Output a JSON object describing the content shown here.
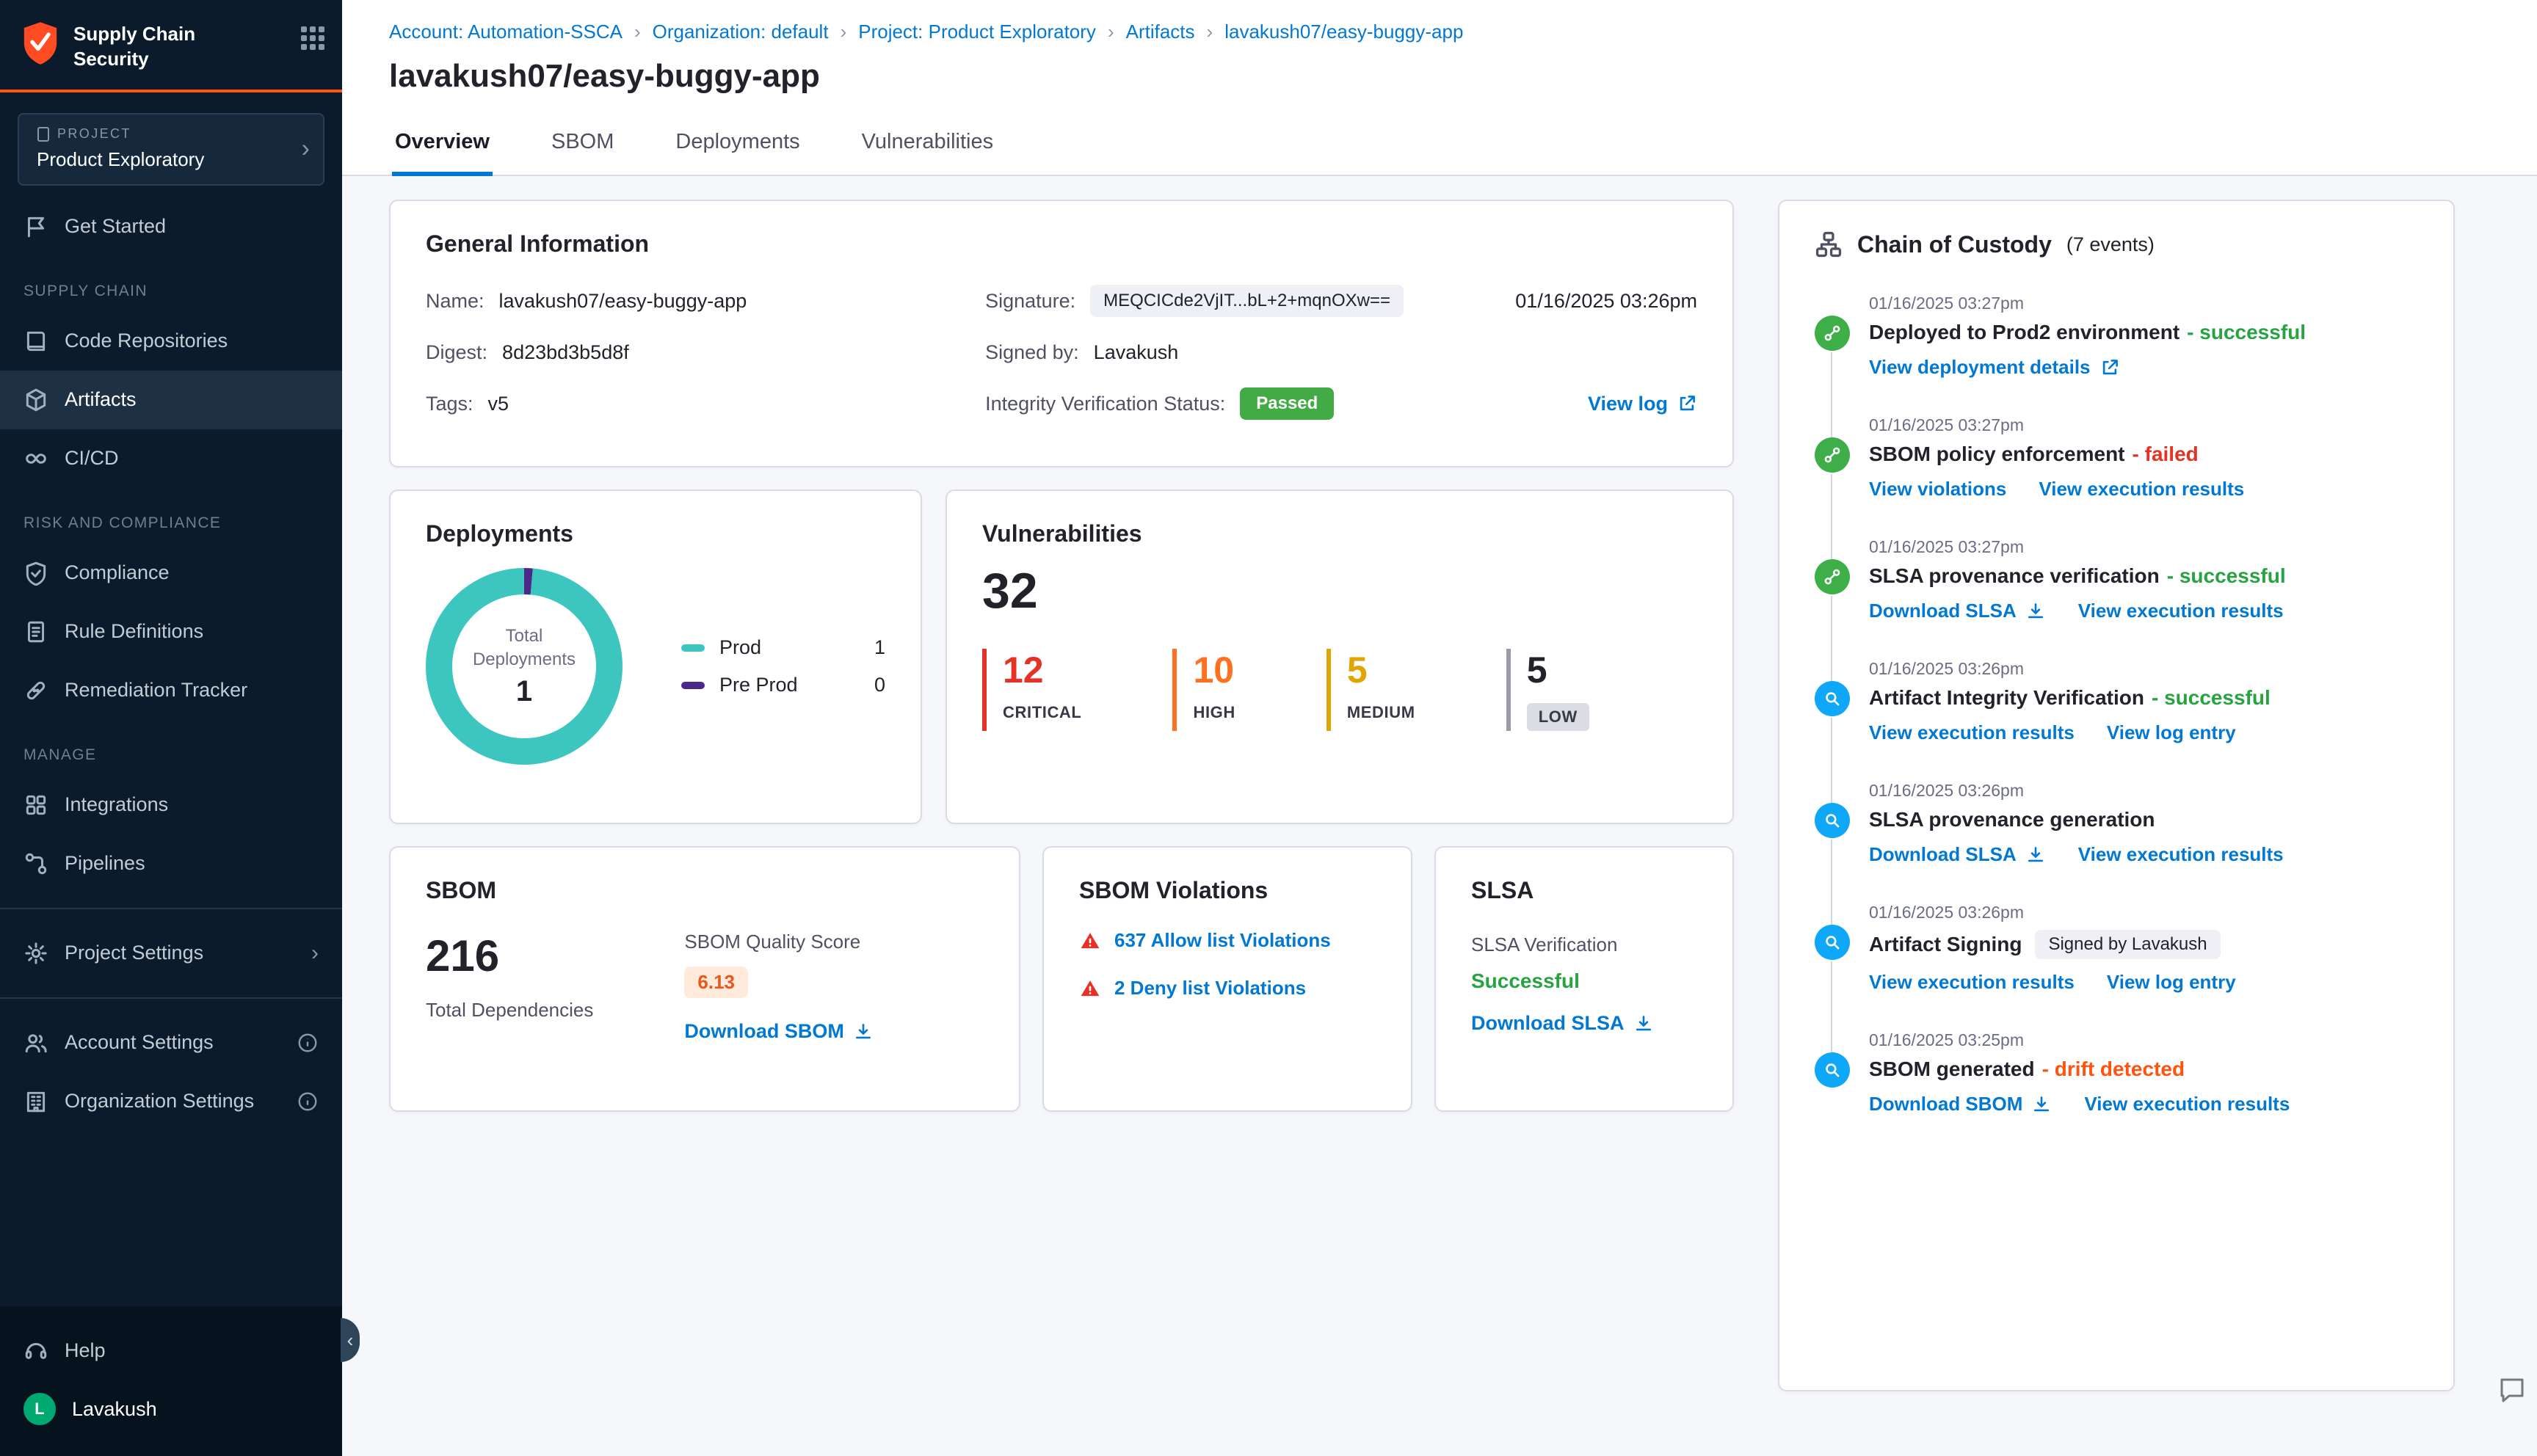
{
  "colors": {
    "primary_blue": "#0278d5",
    "success_green": "#27a341",
    "passed_badge_green": "#42ab45",
    "critical_red": "#e43326",
    "high_orange": "#ff7020",
    "medium_amber": "#e0a500",
    "drift_orange": "#ff5310",
    "teal_prod": "#3dc6c0",
    "purple_preprod": "#4c2889",
    "sidebar_bg": "#0b1b2b",
    "accent_orange": "#ff5310"
  },
  "icons": {
    "chevron_right": "›",
    "chevron_left": "‹"
  },
  "sidebar": {
    "app_title_line1": "Supply Chain",
    "app_title_line2": "Security",
    "project": {
      "label": "PROJECT",
      "name": "Product Exploratory"
    },
    "nav": {
      "get_started": "Get Started",
      "supply_chain_header": "SUPPLY CHAIN",
      "code_repositories": "Code Repositories",
      "artifacts": "Artifacts",
      "cicd": "CI/CD",
      "risk_header": "RISK AND COMPLIANCE",
      "compliance": "Compliance",
      "rule_definitions": "Rule Definitions",
      "remediation_tracker": "Remediation Tracker",
      "manage_header": "MANAGE",
      "integrations": "Integrations",
      "pipelines": "Pipelines",
      "project_settings": "Project Settings",
      "account_settings": "Account Settings",
      "organization_settings": "Organization Settings",
      "help": "Help"
    },
    "user": {
      "initial": "L",
      "name": "Lavakush"
    }
  },
  "breadcrumb": {
    "items": [
      "Account: Automation-SSCA",
      "Organization: default",
      "Project: Product Exploratory",
      "Artifacts",
      "lavakush07/easy-buggy-app"
    ]
  },
  "page": {
    "title": "lavakush07/easy-buggy-app"
  },
  "tabs": {
    "overview": "Overview",
    "sbom": "SBOM",
    "deployments": "Deployments",
    "vulnerabilities": "Vulnerabilities"
  },
  "general_info": {
    "title": "General Information",
    "name_label": "Name:",
    "name_value": "lavakush07/easy-buggy-app",
    "digest_label": "Digest:",
    "digest_value": "8d23bd3b5d8f",
    "tags_label": "Tags:",
    "tags_value": "v5",
    "signature_label": "Signature:",
    "signature_value": "MEQCICde2VjIT...bL+2+mqnOXw==",
    "signature_date": "01/16/2025 03:26pm",
    "signed_by_label": "Signed by:",
    "signed_by_value": "Lavakush",
    "integrity_label": "Integrity Verification Status:",
    "integrity_value": "Passed",
    "view_log": "View log"
  },
  "deployments_card": {
    "title": "Deployments",
    "center_label_line1": "Total",
    "center_label_line2": "Deployments",
    "center_value": "1",
    "values": {
      "prod": 1,
      "pre_prod": 0,
      "total": 1
    },
    "legend": [
      {
        "label": "Prod",
        "value": "1"
      },
      {
        "label": "Pre Prod",
        "value": "0"
      }
    ]
  },
  "vulnerabilities_card": {
    "title": "Vulnerabilities",
    "total": "32",
    "severities": [
      {
        "count": "12",
        "label": "CRITICAL"
      },
      {
        "count": "10",
        "label": "HIGH"
      },
      {
        "count": "5",
        "label": "MEDIUM"
      },
      {
        "count": "5",
        "label": "LOW"
      }
    ]
  },
  "sbom_card": {
    "title": "SBOM",
    "total": "216",
    "total_label": "Total Dependencies",
    "quality_label": "SBOM Quality Score",
    "quality_score": "6.13",
    "download": "Download SBOM"
  },
  "sbom_violations_card": {
    "title": "SBOM Violations",
    "items": [
      {
        "text": "637 Allow list Violations"
      },
      {
        "text": "2 Deny list Violations"
      }
    ]
  },
  "slsa_card": {
    "title": "SLSA",
    "verification_label": "SLSA Verification",
    "status": "Successful",
    "download": "Download SLSA"
  },
  "chain_of_custody": {
    "title": "Chain of Custody",
    "count": "(7 events)",
    "events": [
      {
        "ts": "01/16/2025 03:27pm",
        "title": "Deployed to Prod2 environment",
        "status": "- successful",
        "links": [
          "View deployment details"
        ]
      },
      {
        "ts": "01/16/2025 03:27pm",
        "title": "SBOM policy enforcement",
        "status": "- failed",
        "links": [
          "View violations",
          "View execution results"
        ]
      },
      {
        "ts": "01/16/2025 03:27pm",
        "title": "SLSA provenance verification",
        "status": "- successful",
        "links": [
          "Download SLSA",
          "View execution results"
        ]
      },
      {
        "ts": "01/16/2025 03:26pm",
        "title": "Artifact Integrity Verification",
        "status": "- successful",
        "links": [
          "View execution results",
          "View log entry"
        ]
      },
      {
        "ts": "01/16/2025 03:26pm",
        "title": "SLSA provenance generation",
        "links": [
          "Download SLSA",
          "View execution results"
        ]
      },
      {
        "ts": "01/16/2025 03:26pm",
        "title": "Artifact Signing",
        "badge": "Signed by Lavakush",
        "links": [
          "View execution results",
          "View log entry"
        ]
      },
      {
        "ts": "01/16/2025 03:25pm",
        "title": "SBOM generated",
        "status": "- drift detected",
        "links": [
          "Download SBOM",
          "View execution results"
        ]
      }
    ]
  }
}
